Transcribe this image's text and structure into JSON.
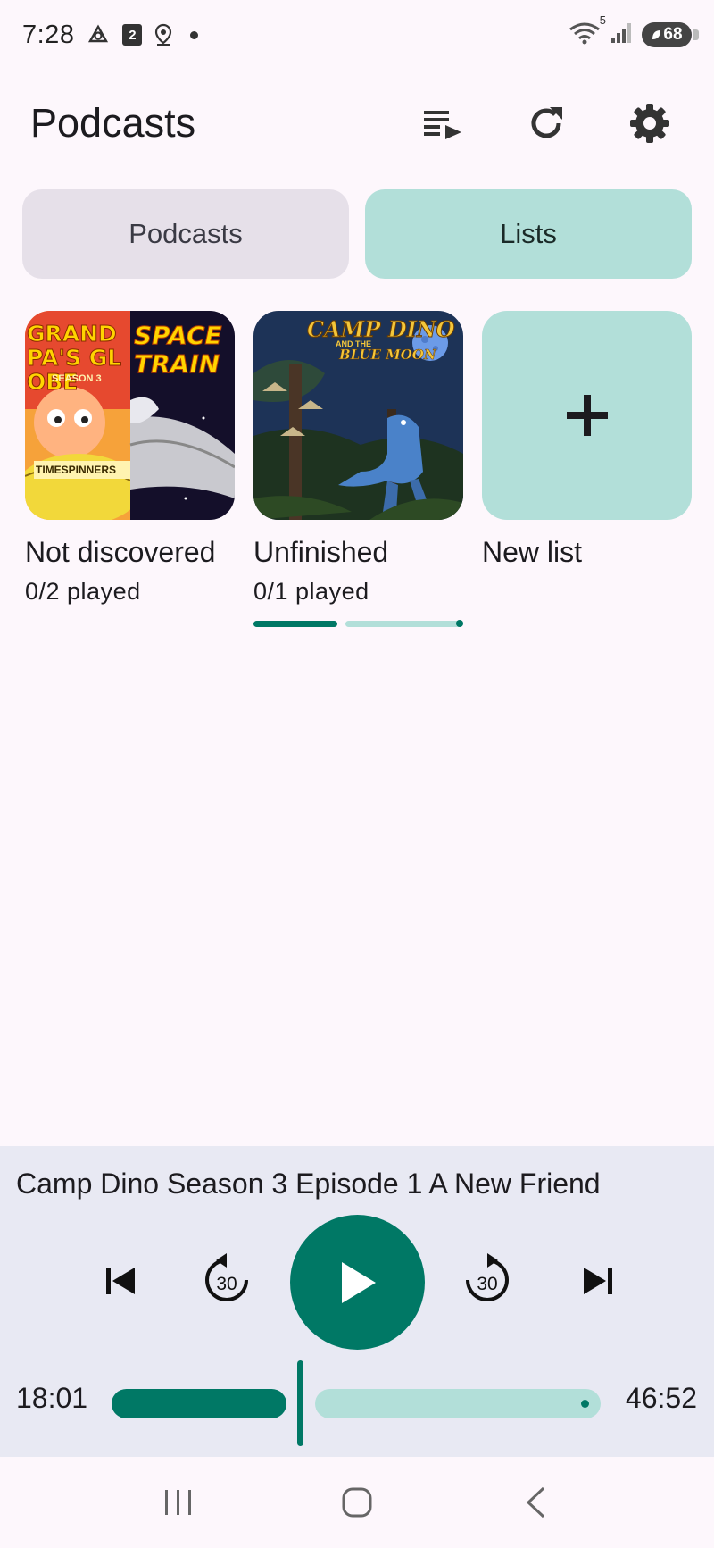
{
  "status_bar": {
    "time": "7:28",
    "calendar_badge": "2",
    "network_badge": "5",
    "battery_level": "68",
    "icons": [
      "cloud-sync-icon",
      "calendar-icon",
      "location-icon",
      "dot-icon",
      "wifi-icon",
      "signal-icon",
      "battery-icon"
    ]
  },
  "app_bar": {
    "title": "Podcasts",
    "actions": [
      "queue-icon",
      "refresh-icon",
      "settings-icon"
    ]
  },
  "tabs": [
    {
      "label": "Podcasts",
      "selected": false
    },
    {
      "label": "Lists",
      "selected": true
    }
  ],
  "lists": [
    {
      "title": "Not discovered",
      "subtitle": "0/2 played",
      "art_text_1": "GRANDPA'S GLOBE",
      "art_text_2": "SEASON 3",
      "art_text_3": "TIMESPINNERS",
      "art_text_4": "SPACE TRAIN"
    },
    {
      "title": "Unfinished",
      "subtitle": "0/1 played",
      "progress": 0.3,
      "art_text_1": "CAMP DINO",
      "art_text_2": "AND THE",
      "art_text_3": "BLUE MOON"
    },
    {
      "title": "New list"
    }
  ],
  "player": {
    "episode_title": "Camp Dino Season 3 Episode 1 A New Friend",
    "current_time": "18:01",
    "total_time": "46:52",
    "skip_back_seconds": "30",
    "skip_forward_seconds": "30",
    "progress": 0.384
  },
  "colors": {
    "accent": "#007865",
    "accent_light": "#b2dfd9",
    "background": "#fdf7fc",
    "player_bg": "#e8e9f3"
  }
}
